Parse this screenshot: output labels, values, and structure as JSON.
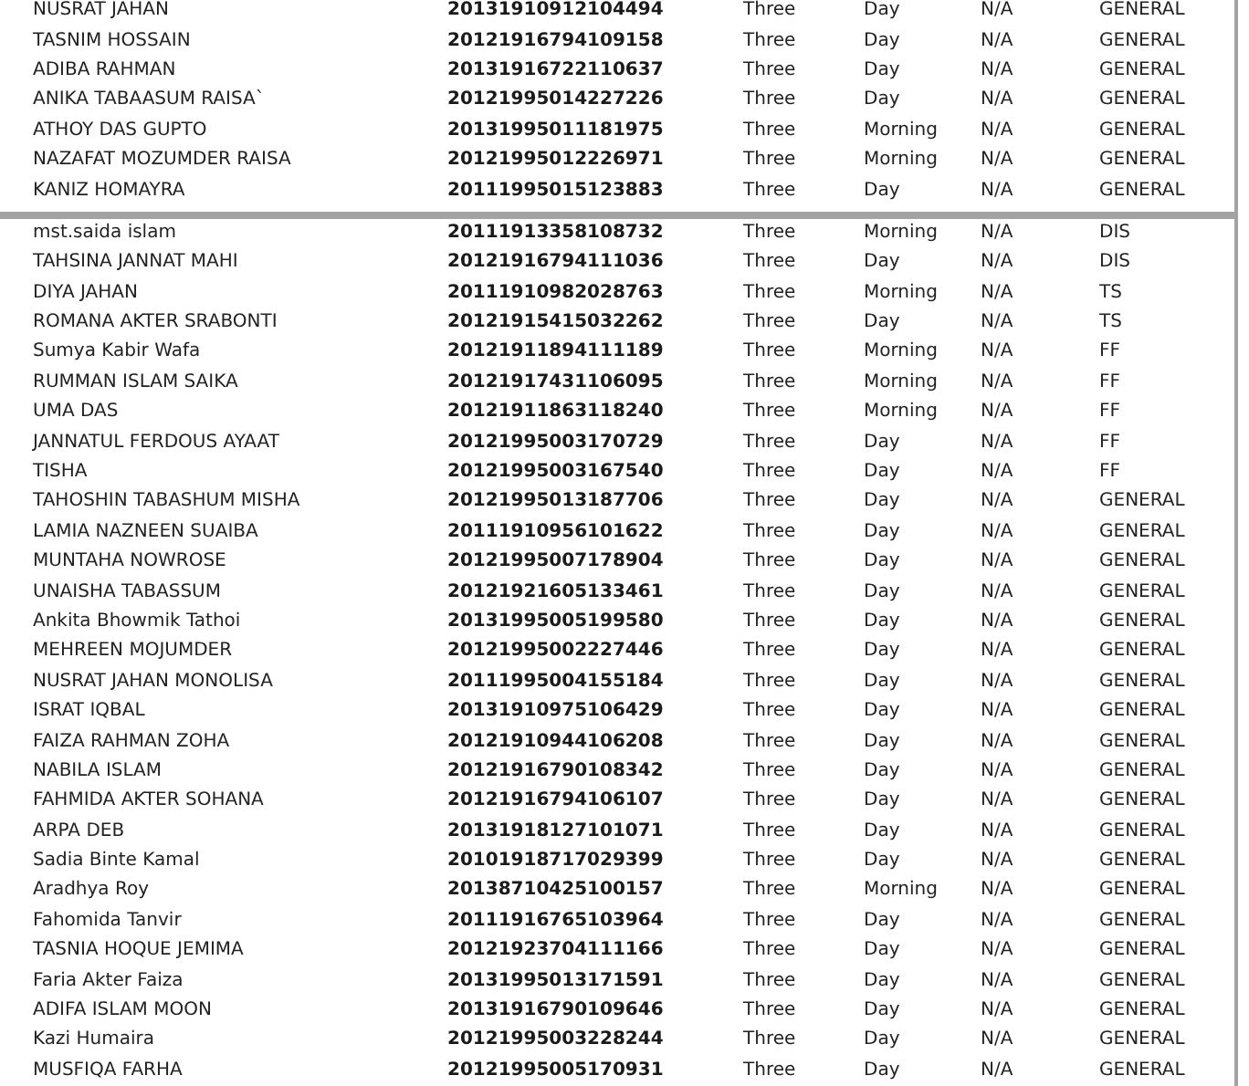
{
  "sections": [
    {
      "rows": [
        [
          "NUSRAT JAHAN",
          "20131910912104494",
          "Three",
          "Day",
          "N/A",
          "GENERAL"
        ],
        [
          "TASNIM HOSSAIN",
          "20121916794109158",
          "Three",
          "Day",
          "N/A",
          "GENERAL"
        ],
        [
          "ADIBA RAHMAN",
          "20131916722110637",
          "Three",
          "Day",
          "N/A",
          "GENERAL"
        ],
        [
          "ANIKA TABAASUM RAISA`",
          "20121995014227226",
          "Three",
          "Day",
          "N/A",
          "GENERAL"
        ],
        [
          "ATHOY DAS GUPTO",
          "20131995011181975",
          "Three",
          "Morning",
          "N/A",
          "GENERAL"
        ],
        [
          "NAZAFAT MOZUMDER RAISA",
          "20121995012226971",
          "Three",
          "Morning",
          "N/A",
          "GENERAL"
        ],
        [
          "KANIZ HOMAYRA",
          "20111995015123883",
          "Three",
          "Day",
          "N/A",
          "GENERAL"
        ]
      ]
    },
    {
      "rows": [
        [
          "mst.saida islam",
          "20111913358108732",
          "Three",
          "Morning",
          "N/A",
          "DIS"
        ],
        [
          "TAHSINA JANNAT MAHI",
          "20121916794111036",
          "Three",
          "Day",
          "N/A",
          "DIS"
        ],
        [
          "DIYA JAHAN",
          "20111910982028763",
          "Three",
          "Morning",
          "N/A",
          "TS"
        ],
        [
          "ROMANA AKTER SRABONTI",
          "20121915415032262",
          "Three",
          "Day",
          "N/A",
          "TS"
        ],
        [
          "Sumya Kabir Wafa",
          "20121911894111189",
          "Three",
          "Morning",
          "N/A",
          "FF"
        ],
        [
          "RUMMAN ISLAM SAIKA",
          "20121917431106095",
          "Three",
          "Morning",
          "N/A",
          "FF"
        ],
        [
          "UMA DAS",
          "20121911863118240",
          "Three",
          "Morning",
          "N/A",
          "FF"
        ],
        [
          "JANNATUL FERDOUS AYAAT",
          "20121995003170729",
          "Three",
          "Day",
          "N/A",
          "FF"
        ],
        [
          "TISHA",
          "20121995003167540",
          "Three",
          "Day",
          "N/A",
          "FF"
        ],
        [
          "TAHOSHIN TABASHUM MISHA",
          "20121995013187706",
          "Three",
          "Day",
          "N/A",
          "GENERAL"
        ],
        [
          "LAMIA NAZNEEN SUAIBA",
          "20111910956101622",
          "Three",
          "Day",
          "N/A",
          "GENERAL"
        ],
        [
          "MUNTAHA NOWROSE",
          "20121995007178904",
          "Three",
          "Day",
          "N/A",
          "GENERAL"
        ],
        [
          "UNAISHA TABASSUM",
          "20121921605133461",
          "Three",
          "Day",
          "N/A",
          "GENERAL"
        ],
        [
          "Ankita Bhowmik Tathoi",
          "20131995005199580",
          "Three",
          "Day",
          "N/A",
          "GENERAL"
        ],
        [
          "MEHREEN MOJUMDER",
          "20121995002227446",
          "Three",
          "Day",
          "N/A",
          "GENERAL"
        ],
        [
          "NUSRAT JAHAN MONOLISA",
          "20111995004155184",
          "Three",
          "Day",
          "N/A",
          "GENERAL"
        ],
        [
          "ISRAT IQBAL",
          "20131910975106429",
          "Three",
          "Day",
          "N/A",
          "GENERAL"
        ],
        [
          "FAIZA RAHMAN ZOHA",
          "20121910944106208",
          "Three",
          "Day",
          "N/A",
          "GENERAL"
        ],
        [
          "NABILA ISLAM",
          "20121916790108342",
          "Three",
          "Day",
          "N/A",
          "GENERAL"
        ],
        [
          "FAHMIDA AKTER SOHANA",
          "20121916794106107",
          "Three",
          "Day",
          "N/A",
          "GENERAL"
        ],
        [
          "ARPA DEB",
          "20131918127101071",
          "Three",
          "Day",
          "N/A",
          "GENERAL"
        ],
        [
          "Sadia Binte Kamal",
          "20101918717029399",
          "Three",
          "Day",
          "N/A",
          "GENERAL"
        ],
        [
          "Aradhya Roy",
          "20138710425100157",
          "Three",
          "Morning",
          "N/A",
          "GENERAL"
        ],
        [
          "Fahomida Tanvir",
          "20111916765103964",
          "Three",
          "Day",
          "N/A",
          "GENERAL"
        ],
        [
          "TASNIA HOQUE JEMIMA",
          "20121923704111166",
          "Three",
          "Day",
          "N/A",
          "GENERAL"
        ],
        [
          "Faria Akter Faiza",
          "20131995013171591",
          "Three",
          "Day",
          "N/A",
          "GENERAL"
        ],
        [
          "ADIFA ISLAM MOON",
          "20131916790109646",
          "Three",
          "Day",
          "N/A",
          "GENERAL"
        ],
        [
          "Kazi Humaira",
          "20121995003228244",
          "Three",
          "Day",
          "N/A",
          "GENERAL"
        ],
        [
          "MUSFIQA FARHA",
          "20121995005170931",
          "Three",
          "Day",
          "N/A",
          "GENERAL"
        ]
      ]
    }
  ]
}
